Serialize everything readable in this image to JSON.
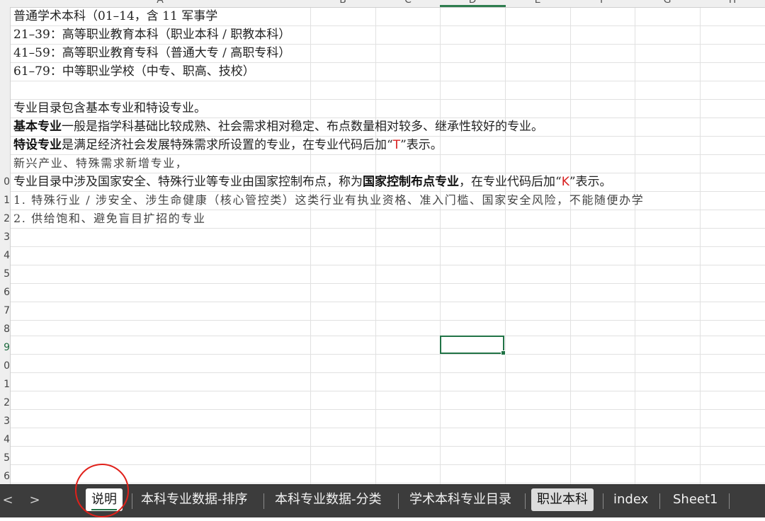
{
  "columns": [
    "A",
    "B",
    "C",
    "D",
    "E",
    "F",
    "G",
    "H"
  ],
  "rows": [
    "",
    "",
    "",
    "",
    "",
    "",
    "",
    "",
    "",
    "0",
    "1",
    "2",
    "3",
    "4",
    "5",
    "6",
    "7",
    "8",
    "9",
    "0",
    "1",
    "2",
    "3",
    "4",
    "5",
    "6"
  ],
  "cells": {
    "r1": "普通学术本科（01–14，含 11 军事学",
    "r2": "21–39：高等职业教育本科（职业本科 / 职教本科）",
    "r3": "41–59：高等职业教育专科（普通大专 / 高职专科）",
    "r4": "61–79：中等职业学校（中专、职高、技校）",
    "r6": "专业目录包含基本专业和特设专业。",
    "r7_bold": "基本专业",
    "r7_rest": "一般是指学科基础比较成熟、社会需求相对稳定、布点数量相对较多、继承性较好的专业。",
    "r8_bold": "特设专业",
    "r8_pre": "是满足经济社会发展特殊需求所设置的专业，在专业代码后加“",
    "r8_code": "T",
    "r8_post": "”表示。",
    "r9": "新兴产业、特殊需求新增专业，",
    "r10_pre": "专业目录中涉及国家安全、特殊行业等专业由国家控制布点，称为",
    "r10_bold": "国家控制布点专业",
    "r10_mid": "，在专业代码后加“",
    "r10_code": "K",
    "r10_post": "”表示。",
    "r11": "1. 特殊行业 / 涉安全、涉生命健康（核心管控类）这类行业有执业资格、准入门槛、国家安全风险，不能随便办学",
    "r12": "2. 供给饱和、避免盲目扩招的专业"
  },
  "nav": {
    "prev": "<",
    "next": ">"
  },
  "tabs": [
    "说明",
    "本科专业数据-排序",
    "本科专业数据-分类",
    "学术本科专业目录",
    "职业本科",
    "index",
    "Sheet1"
  ],
  "active_tab": "说明",
  "colors": {
    "accent_green": "#217346",
    "code_red": "#d81e1e",
    "annotation_red": "#e0201a"
  }
}
